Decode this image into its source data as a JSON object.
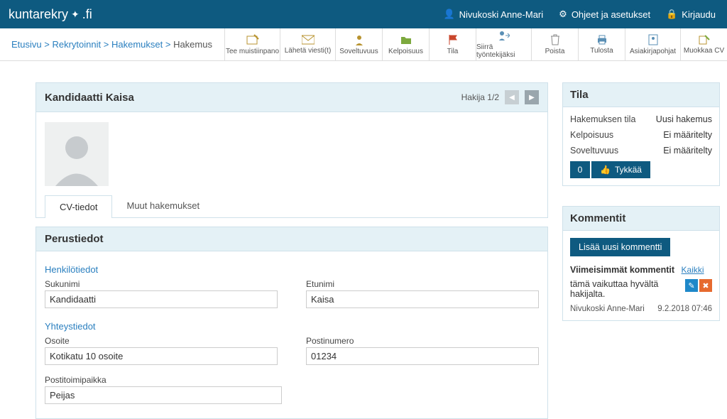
{
  "header": {
    "logo": "kuntarekry",
    "logo_suffix": ".fi",
    "user": "Nivukoski Anne-Mari",
    "help": "Ohjeet ja asetukset",
    "logout": "Kirjaudu"
  },
  "breadcrumbs": {
    "items": [
      "Etusivu",
      "Rekrytoinnit",
      "Hakemukset"
    ],
    "current": "Hakemus"
  },
  "tools": {
    "note": "Tee muistiinpano",
    "send": "Lähetä viesti(t)",
    "suit": "Soveltuvuus",
    "elig": "Kelpoisuus",
    "state": "Tila",
    "move": "Siirrä työntekijäksi",
    "del": "Poista",
    "print": "Tulosta",
    "docs": "Asiakirjapohjat",
    "editcv": "Muokkaa CV"
  },
  "candidate": {
    "title": "Kandidaatti Kaisa",
    "pager": "Hakija 1/2",
    "tabs": {
      "cv": "CV-tiedot",
      "other": "Muut hakemukset"
    }
  },
  "perustiedot": {
    "title": "Perustiedot",
    "henkilotiedot": "Henkilötiedot",
    "yhteystiedot": "Yhteystiedot",
    "sukunimi_label": "Sukunimi",
    "sukunimi": "Kandidaatti",
    "etunimi_label": "Etunimi",
    "etunimi": "Kaisa",
    "osoite_label": "Osoite",
    "osoite": "Kotikatu 10 osoite",
    "postinumero_label": "Postinumero",
    "postinumero": "01234",
    "postitoimipaikka_label": "Postitoimipaikka",
    "postitoimipaikka": "Peijas"
  },
  "tila": {
    "title": "Tila",
    "hakemuksen_tila_k": "Hakemuksen tila",
    "hakemuksen_tila_v": "Uusi hakemus",
    "kelpoisuus_k": "Kelpoisuus",
    "kelpoisuus_v": "Ei määritelty",
    "soveltuvuus_k": "Soveltuvuus",
    "soveltuvuus_v": "Ei määritelty",
    "like_count": "0",
    "like_label": "Tykkää"
  },
  "kommentit": {
    "title": "Kommentit",
    "add": "Lisää uusi kommentti",
    "latest": "Viimeisimmät kommentit",
    "all": "Kaikki",
    "text": "tämä vaikuttaa hyvältä hakijalta.",
    "author": "Nivukoski Anne-Mari",
    "time": "9.2.2018 07:46"
  }
}
